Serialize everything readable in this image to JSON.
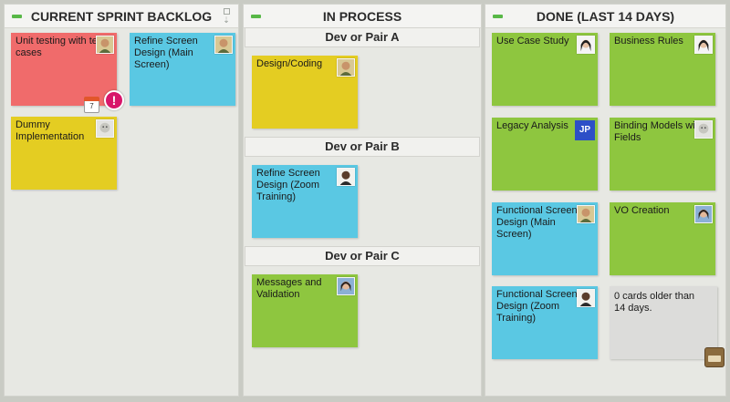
{
  "lanes": {
    "backlog": {
      "title": "CURRENT SPRINT BACKLOG",
      "cards": [
        {
          "label": "Unit testing with test cases",
          "color": "#f06b6b",
          "calendar_day": "7",
          "alert_glyph": "!"
        },
        {
          "label": "Refine Screen Design (Main Screen)",
          "color": "#5ac8e3"
        },
        {
          "label": "Dummy Implementation",
          "color": "#e4cd22"
        }
      ]
    },
    "in_process": {
      "title": "IN PROCESS",
      "sublanes": [
        {
          "title": "Dev or Pair A",
          "card": {
            "label": "Design/Coding",
            "color": "#e4cd22"
          }
        },
        {
          "title": "Dev or Pair B",
          "card": {
            "label": "Refine Screen Design (Zoom Training)",
            "color": "#5ac8e3"
          }
        },
        {
          "title": "Dev or Pair C",
          "card": {
            "label": "Messages and Validation",
            "color": "#8ec63f"
          }
        }
      ]
    },
    "done": {
      "title": "DONE (LAST 14 DAYS)",
      "cards": [
        {
          "label": "Use Case Study",
          "color": "#8ec63f"
        },
        {
          "label": "Business Rules",
          "color": "#8ec63f"
        },
        {
          "label": "Legacy Analysis",
          "color": "#8ec63f",
          "initials": "JP"
        },
        {
          "label": "Binding Models with Fields",
          "color": "#8ec63f"
        },
        {
          "label": "Functional Screen Design (Main Screen)",
          "color": "#5ac8e3"
        },
        {
          "label": "VO Creation",
          "color": "#8ec63f"
        },
        {
          "label": "Functional Screen Design (Zoom Training)",
          "color": "#5ac8e3"
        },
        {
          "label": "0 cards older than 14 days.",
          "color": "#dcdcda"
        }
      ]
    }
  }
}
